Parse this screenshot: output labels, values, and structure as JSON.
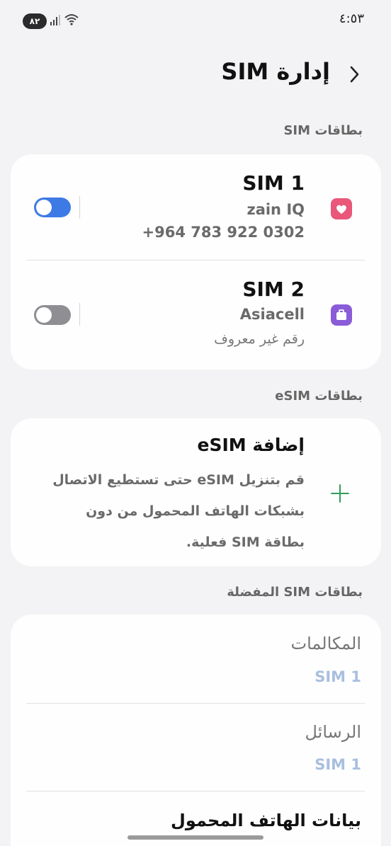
{
  "status_bar": {
    "time": "٤:٥٣",
    "battery": "٨٢"
  },
  "header": {
    "title": "إدارة SIM"
  },
  "sim_cards": {
    "section_label": "بطاقات SIM",
    "sim1": {
      "name": "SIM 1",
      "carrier": "zain IQ",
      "number": "+964 783 922 0302",
      "enabled": true,
      "icon": "heart-icon",
      "icon_color": "#e9577a",
      "toggle_color": "#3e7ae6"
    },
    "sim2": {
      "name": "SIM 2",
      "carrier": "Asiacell",
      "number": "رقم غير معروف",
      "enabled": true,
      "icon": "briefcase-icon",
      "icon_color": "#8a5cd8",
      "toggle_color": "#8e8e93"
    }
  },
  "esim": {
    "section_label": "بطاقات eSIM",
    "title": "إضافة eSIM",
    "description": "قم بتنزيل eSIM حتى تستطيع الاتصال بشبكات الهاتف المحمول من دون بطاقة SIM فعلية.",
    "icon": "plus-icon",
    "icon_color": "#2e9e5a"
  },
  "preferred": {
    "section_label": "بطاقات SIM المفضلة",
    "calls_label": "المكالمات",
    "calls_value": "SIM 1",
    "messages_label": "الرسائل",
    "messages_value": "SIM 1",
    "mobile_data_label": "بيانات الهاتف المحمول"
  }
}
